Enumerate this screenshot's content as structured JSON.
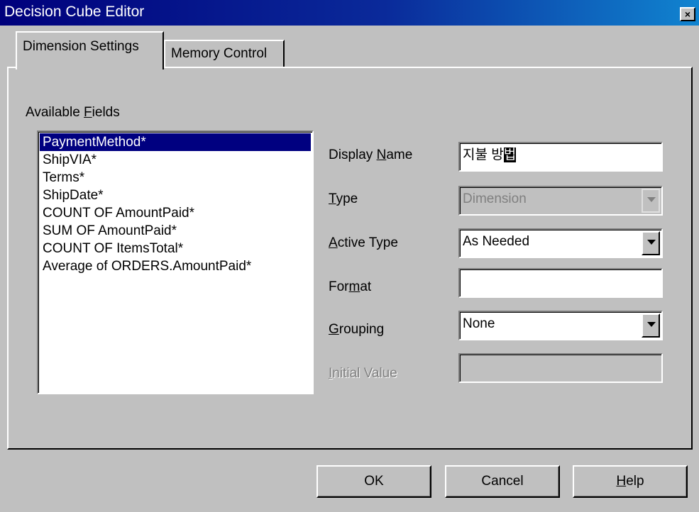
{
  "window": {
    "title": "Decision Cube Editor",
    "close_glyph": "×"
  },
  "tabs": [
    {
      "label": "Dimension Settings"
    },
    {
      "label": "Memory Control"
    }
  ],
  "available_fields": {
    "label_pre": "Available ",
    "label_key": "F",
    "label_post": "ields",
    "items": [
      "PaymentMethod*",
      "ShipVIA*",
      "Terms*",
      "ShipDate*",
      "COUNT OF AmountPaid*",
      "SUM OF AmountPaid*",
      "COUNT OF ItemsTotal*",
      "Average of ORDERS.AmountPaid*"
    ],
    "selected_index": 0
  },
  "form": {
    "display_name": {
      "label_pre": "Display ",
      "label_key": "N",
      "label_post": "ame",
      "value": "지불 방",
      "ime_char": "법"
    },
    "type": {
      "label_key": "T",
      "label_post": "ype",
      "value": "Dimension"
    },
    "active_type": {
      "label_key": "A",
      "label_post": "ctive Type",
      "value": "As Needed"
    },
    "format": {
      "label_pre": "For",
      "label_key": "m",
      "label_post": "at",
      "value": ""
    },
    "grouping": {
      "label_key": "G",
      "label_post": "rouping",
      "value": "None"
    },
    "initial_value": {
      "label_key": "I",
      "label_post": "nitial Value",
      "value": ""
    }
  },
  "buttons": {
    "ok": "OK",
    "cancel": "Cancel",
    "help_key": "H",
    "help_post": "elp"
  },
  "colors": {
    "selection": "#000080",
    "face": "#c0c0c0",
    "title_start": "#00007c"
  }
}
